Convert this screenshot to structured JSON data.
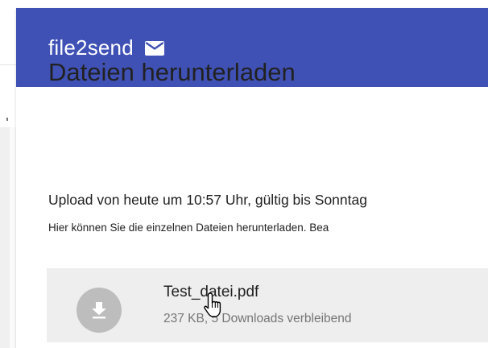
{
  "app": {
    "brand": "file2send",
    "brand_icon": "mail-icon",
    "header_color": "#3f51b5"
  },
  "main": {
    "title": "Dateien herunterladen",
    "subtitle": "Upload von heute um 10:57 Uhr, gültig bis Sonntag",
    "hint": "Hier können Sie die einzelnen Dateien herunterladen. Bea"
  },
  "files": [
    {
      "name": "Test_datei.pdf",
      "meta": "237 KB, 5 Downloads verbleibend",
      "icon": "download-icon"
    }
  ]
}
